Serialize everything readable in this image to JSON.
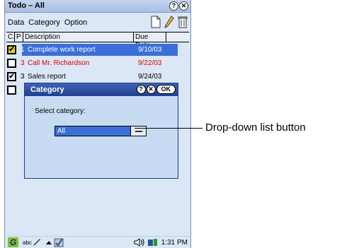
{
  "window": {
    "title": "Todo – All",
    "help_glyph": "?",
    "close_glyph": "✕"
  },
  "menu": {
    "items": [
      "Data",
      "Category",
      "Option"
    ]
  },
  "table": {
    "headers": [
      "C.",
      "P",
      "Description",
      "Due Date"
    ],
    "rows": [
      {
        "checked": true,
        "priority": "1",
        "description": "Complete work report",
        "due": "9/10/03",
        "selected": true,
        "color": "#ffffff"
      },
      {
        "checked": false,
        "priority": "3",
        "description": "Call Mr. Richardson",
        "due": "9/22/03",
        "selected": false,
        "color": "#e00000"
      },
      {
        "checked": true,
        "priority": "3",
        "description": "Sales report",
        "due": "9/24/03",
        "selected": false,
        "color": "#000000"
      },
      {
        "checked": false,
        "priority": "",
        "description": "",
        "due": "",
        "selected": false,
        "color": "#000000"
      }
    ]
  },
  "dialog": {
    "title": "Category",
    "help_glyph": "?",
    "close_glyph": "✕",
    "ok_label": "OK",
    "prompt": "Select category:",
    "dropdown_value": "All"
  },
  "status": {
    "time": "1:31 PM",
    "logo_glyph": "G",
    "ink_label": "abc"
  },
  "callout": {
    "text": "Drop-down list button"
  },
  "colors": {
    "selection": "#3a6fd8",
    "dialog_title": "#203f8f",
    "overdue": "#e00000"
  }
}
